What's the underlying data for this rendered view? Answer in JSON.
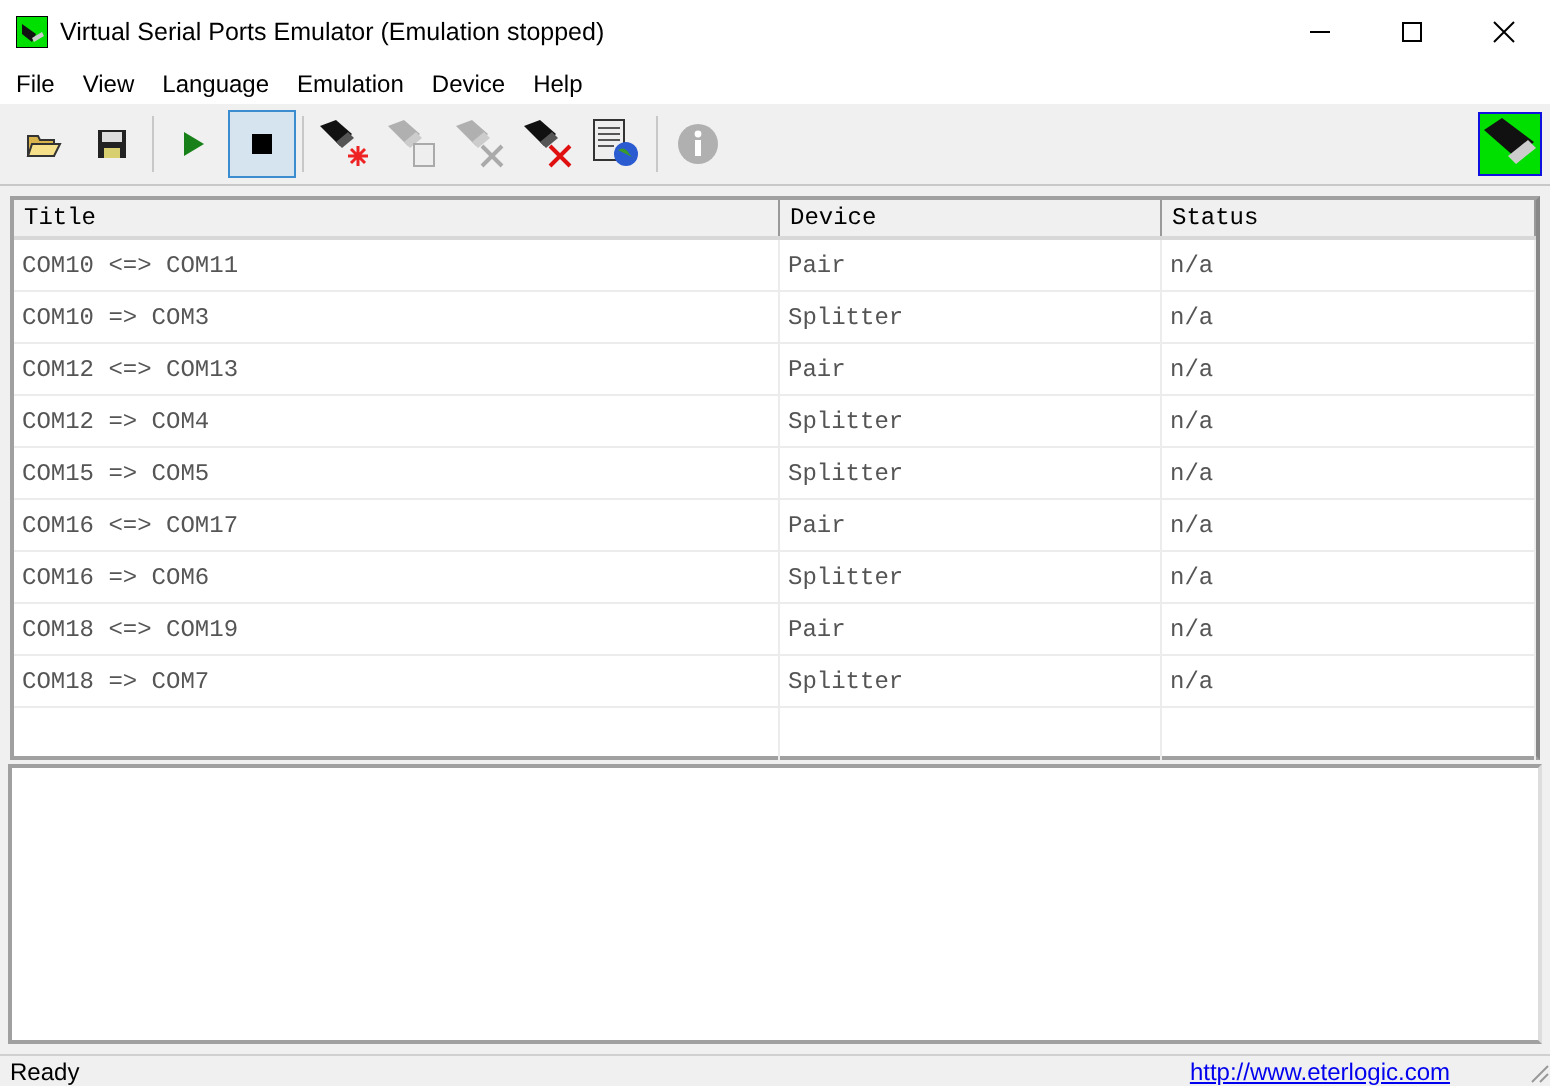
{
  "window": {
    "title": "Virtual Serial Ports Emulator (Emulation stopped)"
  },
  "menu": [
    "File",
    "View",
    "Language",
    "Emulation",
    "Device",
    "Help"
  ],
  "toolbar": [
    {
      "kind": "open",
      "disabled": false,
      "pressed": false
    },
    {
      "kind": "save",
      "disabled": false,
      "pressed": false
    },
    {
      "kind": "sep"
    },
    {
      "kind": "play",
      "disabled": false,
      "pressed": false
    },
    {
      "kind": "stop",
      "disabled": false,
      "pressed": true
    },
    {
      "kind": "sep"
    },
    {
      "kind": "new-device",
      "disabled": false,
      "pressed": false
    },
    {
      "kind": "edit-device",
      "disabled": true,
      "pressed": false
    },
    {
      "kind": "delete-device",
      "disabled": true,
      "pressed": false
    },
    {
      "kind": "delete-all",
      "disabled": false,
      "pressed": false
    },
    {
      "kind": "web",
      "disabled": false,
      "pressed": false
    },
    {
      "kind": "sep"
    },
    {
      "kind": "info",
      "disabled": true,
      "pressed": false
    }
  ],
  "table": {
    "columns": [
      "Title",
      "Device",
      "Status"
    ],
    "rows": [
      [
        "COM10 <=> COM11",
        "Pair",
        "n/a"
      ],
      [
        "COM10 => COM3",
        "Splitter",
        "n/a"
      ],
      [
        "COM12 <=> COM13",
        "Pair",
        "n/a"
      ],
      [
        "COM12 => COM4",
        "Splitter",
        "n/a"
      ],
      [
        "COM15 => COM5",
        "Splitter",
        "n/a"
      ],
      [
        "COM16 <=> COM17",
        "Pair",
        "n/a"
      ],
      [
        "COM16 => COM6",
        "Splitter",
        "n/a"
      ],
      [
        "COM18 <=> COM19",
        "Pair",
        "n/a"
      ],
      [
        "COM18 => COM7",
        "Splitter",
        "n/a"
      ]
    ]
  },
  "status_bar": {
    "text": "Ready",
    "link": "http://www.eterlogic.com"
  }
}
